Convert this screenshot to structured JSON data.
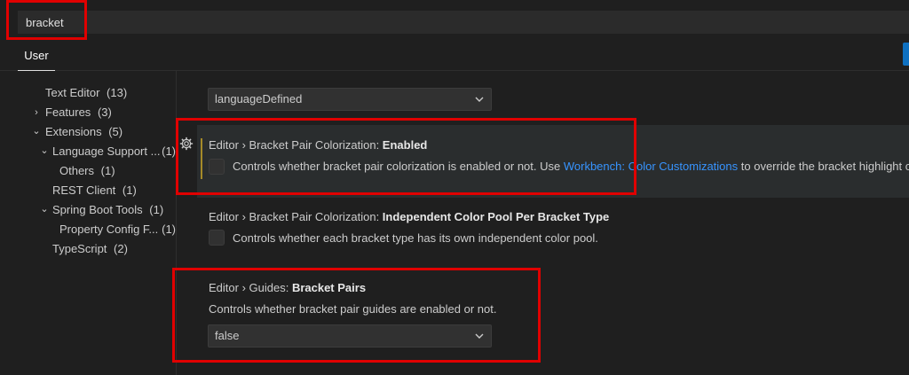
{
  "search": {
    "value": "bracket"
  },
  "tabs": {
    "user_label": "User"
  },
  "tree": {
    "items": [
      {
        "label": "Text Editor",
        "count": "(13)",
        "chevron": ""
      },
      {
        "label": "Features",
        "count": "(3)",
        "chevron": "›"
      },
      {
        "label": "Extensions",
        "count": "(5)",
        "chevron": "⌄"
      },
      {
        "label": "Language Support ...",
        "count": "(1)",
        "chevron": "⌄"
      },
      {
        "label": "Others",
        "count": "(1)",
        "chevron": ""
      },
      {
        "label": "REST Client",
        "count": "(1)",
        "chevron": ""
      },
      {
        "label": "Spring Boot Tools",
        "count": "(1)",
        "chevron": "⌄"
      },
      {
        "label": "Property Config F...",
        "count": "(1)",
        "chevron": ""
      },
      {
        "label": "TypeScript",
        "count": "(2)",
        "chevron": ""
      }
    ]
  },
  "settings": {
    "prev_dropdown_value": "languageDefined",
    "colorization": {
      "category": "Editor › Bracket Pair Colorization: ",
      "name": "Enabled",
      "desc_before": "Controls whether bracket pair colorization is enabled or not. Use ",
      "link": "Workbench: Color Customizations",
      "desc_after": " to override the bracket highlight c"
    },
    "independent_pool": {
      "category": "Editor › Bracket Pair Colorization: ",
      "name": "Independent Color Pool Per Bracket Type",
      "desc": "Controls whether each bracket type has its own independent color pool."
    },
    "guides": {
      "category": "Editor › Guides: ",
      "name": "Bracket Pairs",
      "desc": "Controls whether bracket pair guides are enabled or not.",
      "dropdown_value": "false"
    }
  },
  "colors": {
    "accent": "#0e70c0",
    "link": "#3794ff",
    "highlight": "#e00000",
    "modified": "#a58a28"
  }
}
